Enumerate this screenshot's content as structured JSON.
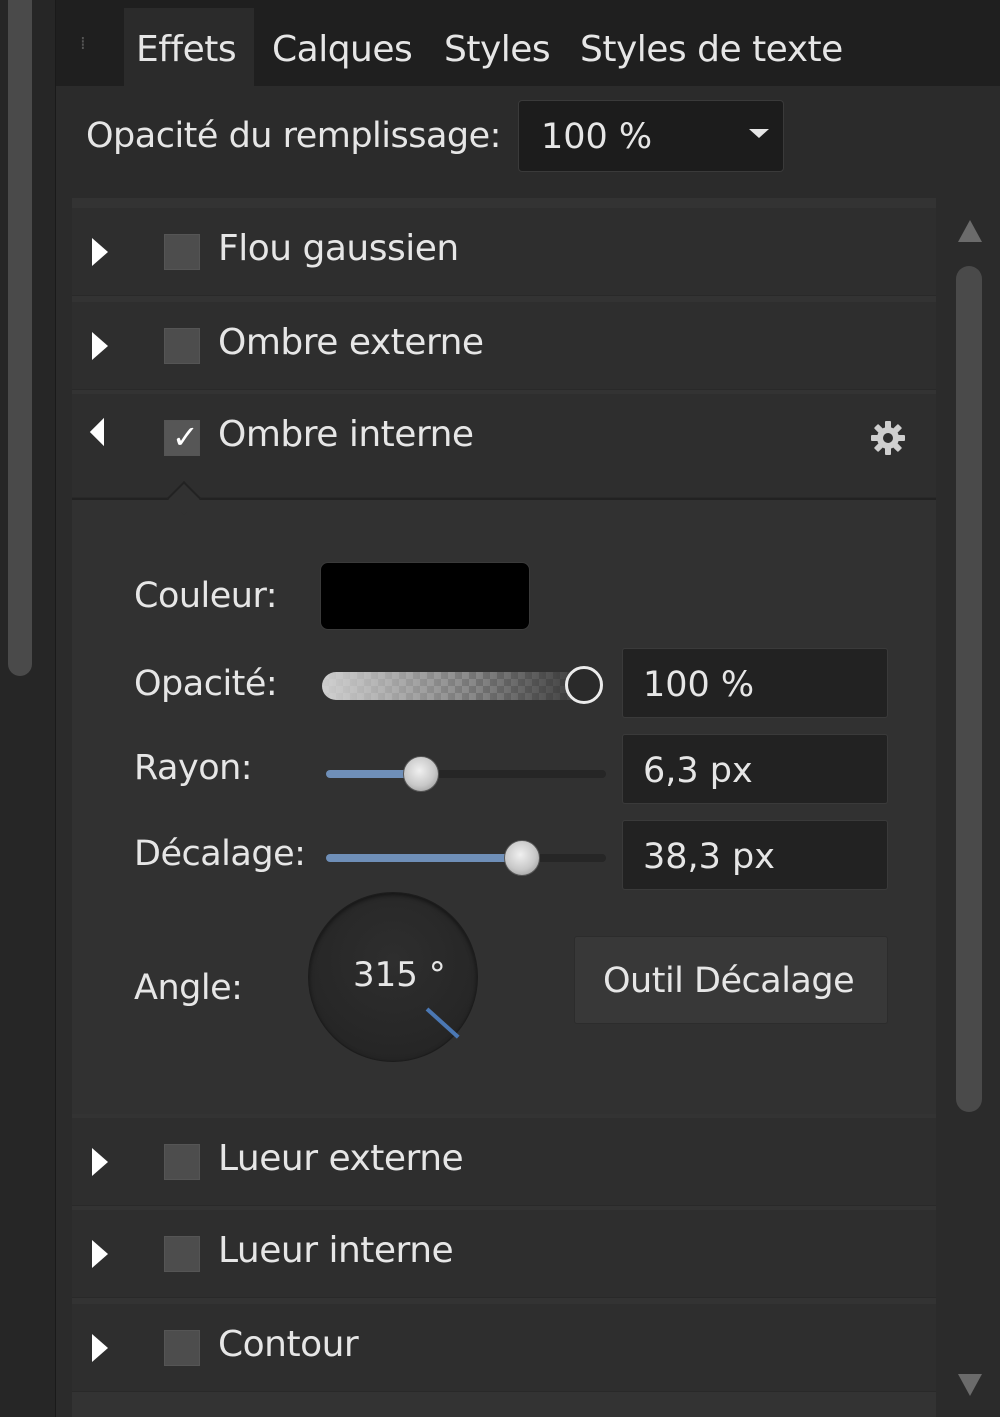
{
  "tabs": [
    {
      "label": "Effets",
      "active": true
    },
    {
      "label": "Calques",
      "active": false
    },
    {
      "label": "Styles",
      "active": false
    },
    {
      "label": "Styles de texte",
      "active": false
    }
  ],
  "fill_opacity": {
    "label": "Opacité du remplissage:",
    "value": "100 %"
  },
  "effects": [
    {
      "label": "Flou gaussien",
      "checked": false,
      "expanded": false
    },
    {
      "label": "Ombre externe",
      "checked": false,
      "expanded": false
    },
    {
      "label": "Ombre interne",
      "checked": true,
      "expanded": true
    },
    {
      "label": "Lueur externe",
      "checked": false,
      "expanded": false
    },
    {
      "label": "Lueur interne",
      "checked": false,
      "expanded": false
    },
    {
      "label": "Contour",
      "checked": false,
      "expanded": false
    }
  ],
  "inner_shadow": {
    "color_label": "Couleur:",
    "color": "#000000",
    "opacity_label": "Opacité:",
    "opacity_value": "100 %",
    "opacity_level": 1.0,
    "radius_label": "Rayon:",
    "radius_value": "6,3 px",
    "radius_level": 0.34,
    "offset_label": "Décalage:",
    "offset_value": "38,3 px",
    "offset_level": 0.7,
    "angle_label": "Angle:",
    "angle_value": "315 °",
    "tool_button": "Outil Décalage"
  },
  "icons": {
    "expand": "triangle-right-icon",
    "collapse": "triangle-down-icon",
    "settings": "gear-icon",
    "dropdown": "caret-down-icon"
  },
  "colors": {
    "accent": "#6f8fb8",
    "panel_bg": "#333333",
    "text": "#e6e6e6"
  }
}
